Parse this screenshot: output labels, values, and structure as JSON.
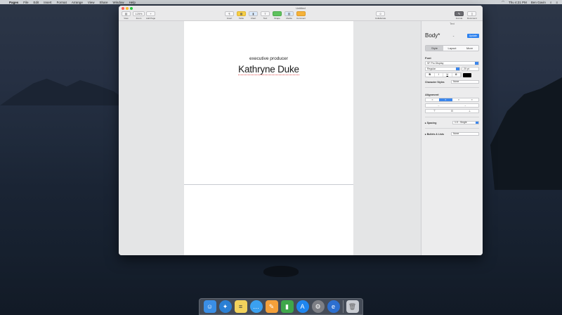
{
  "menubar": {
    "app_name": "Pages",
    "items": [
      "File",
      "Edit",
      "Insert",
      "Format",
      "Arrange",
      "View",
      "Share",
      "Window",
      "Help"
    ],
    "clock": "Thu 4:21 PM",
    "user": "Ben Gavin"
  },
  "window": {
    "title": "Untitled"
  },
  "toolbar": {
    "view_label": "View",
    "zoom_label": "Zoom",
    "zoom_value": "125%",
    "add_page_label": "Add Page",
    "insert_label": "Insert",
    "table_label": "Table",
    "chart_label": "Chart",
    "text_label": "Text",
    "shape_label": "Shape",
    "media_label": "Media",
    "comment_label": "Comment",
    "collaborate_label": "Collaborate",
    "format_label": "Format",
    "document_label": "Document"
  },
  "document": {
    "subtitle": "executive producer",
    "name": "Kathryne Duke"
  },
  "inspector": {
    "header": "Text",
    "paragraph_style": "Body*",
    "update_label": "Update",
    "tabs": [
      "Style",
      "Layout",
      "More"
    ],
    "font_label": "Font",
    "font_family": "SF Pro Display",
    "font_weight": "Regular",
    "font_size": "20 pt",
    "style_buttons": [
      "B",
      "I",
      "U",
      "⚙"
    ],
    "char_styles_label": "Character Styles",
    "char_styles_value": "None",
    "alignment_label": "Alignment",
    "spacing_label": "Spacing",
    "spacing_value": "1.0 - Single",
    "bullets_label": "Bullets & Lists",
    "bullets_value": "None",
    "accent_color": "#3b86ec"
  },
  "dock": {
    "apps": [
      {
        "name": "Finder",
        "icon": "finder-icon",
        "color": "#3a8ee6"
      },
      {
        "name": "Safari",
        "icon": "safari-icon",
        "color": "#2a7fd4"
      },
      {
        "name": "Notes",
        "icon": "notes-icon",
        "color": "#f2d25c"
      },
      {
        "name": "Messages",
        "icon": "messages-icon",
        "color": "#3aa0f0"
      },
      {
        "name": "Pages",
        "icon": "pages-icon",
        "color": "#f4a03a"
      },
      {
        "name": "Numbers",
        "icon": "numbers-icon",
        "color": "#3fa74a"
      },
      {
        "name": "App Store",
        "icon": "app-store-icon",
        "color": "#1f86f0"
      },
      {
        "name": "System Preferences",
        "icon": "system-preferences-icon",
        "color": "#7d7f85"
      },
      {
        "name": "Edge",
        "icon": "browser-icon",
        "color": "#2c6fd0"
      },
      {
        "name": "Trash",
        "icon": "trash-icon",
        "color": "#c9ccd2"
      }
    ]
  }
}
